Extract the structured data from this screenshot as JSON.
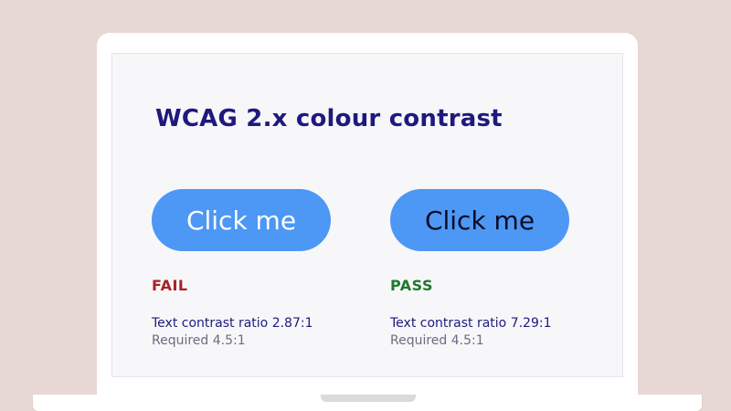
{
  "title": "WCAG 2.x colour contrast",
  "examples": [
    {
      "button_label": "Click me",
      "status": "FAIL",
      "ratio_text": "Text contrast ratio 2.87:1",
      "required_text": "Required 4.5:1"
    },
    {
      "button_label": "Click me",
      "status": "PASS",
      "ratio_text": "Text contrast ratio 7.29:1",
      "required_text": "Required 4.5:1"
    }
  ],
  "colors": {
    "background": "#e8d8d3",
    "title": "#1e1a7d",
    "button": "#4d97f5",
    "fail": "#a72424",
    "pass": "#1d7b2a"
  }
}
